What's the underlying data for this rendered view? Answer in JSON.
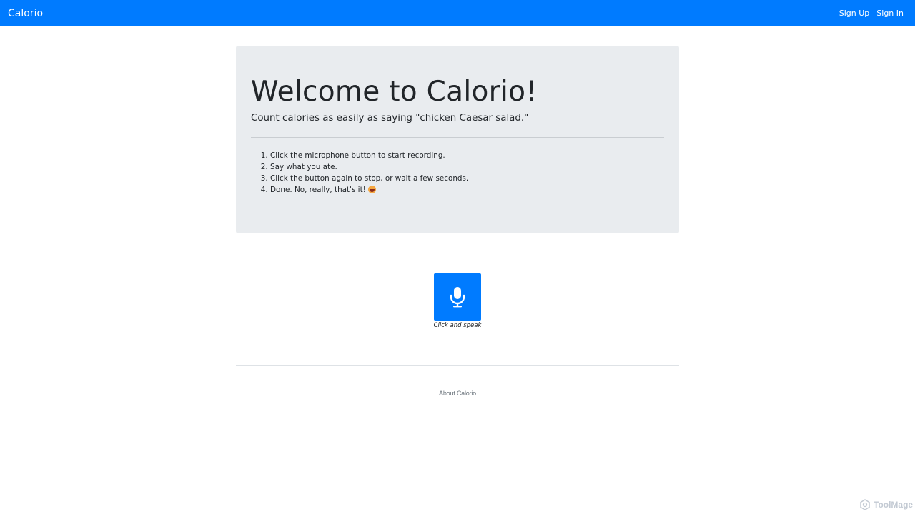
{
  "navbar": {
    "brand": "Calorio",
    "links": [
      {
        "label": "Sign Up"
      },
      {
        "label": "Sign In"
      }
    ],
    "color": "#007bff"
  },
  "jumbotron": {
    "title": "Welcome to Calorio!",
    "lead": "Count calories as easily as saying \"chicken Caesar salad.\"",
    "steps": [
      "Click the microphone button to start recording.",
      "Say what you ate.",
      "Click the button again to stop, or wait a few seconds.",
      "Done. No, really, that's it!"
    ],
    "step4_emoji": "grinning-face-icon",
    "background": "#e9ecef"
  },
  "mic": {
    "icon": "microphone-icon",
    "caption": "Click and speak"
  },
  "footer": {
    "link": "About Calorio"
  },
  "watermark": {
    "label": "ToolMage",
    "icon": "toolmage-logo-icon"
  }
}
